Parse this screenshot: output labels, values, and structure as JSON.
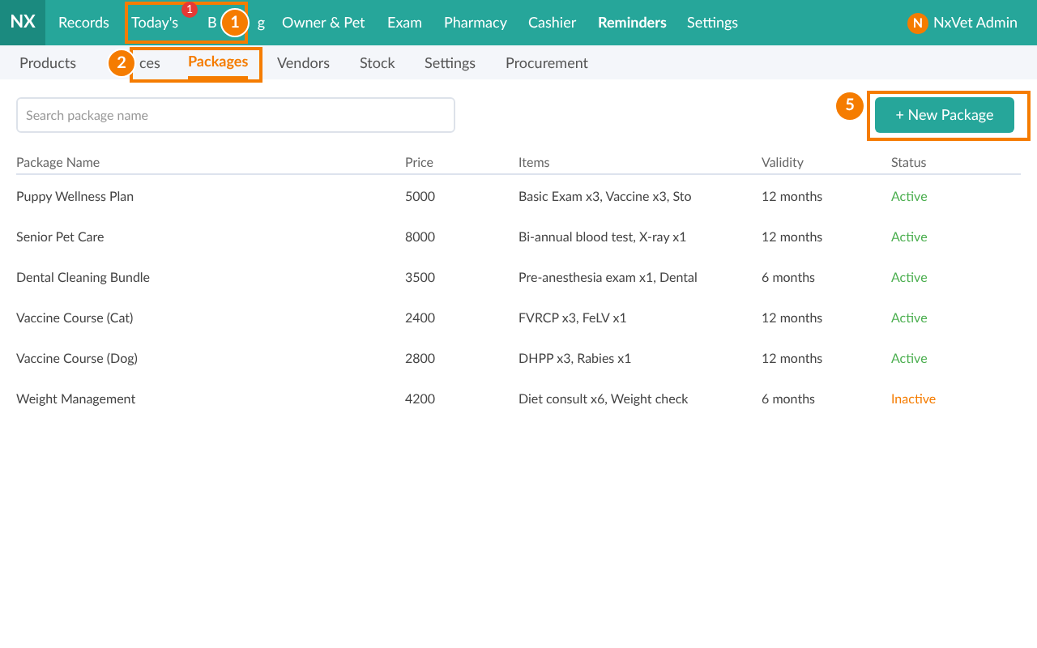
{
  "brand": "NX",
  "nav": [
    {
      "parts": [
        "Records"
      ],
      "selected": false
    },
    {
      "parts": [
        "Today's"
      ],
      "selected": false,
      "badge": "1"
    },
    {
      "parts": [
        "B",
        "g"
      ],
      "selected": false
    },
    {
      "parts": [
        "Owner & Pet"
      ],
      "selected": false
    },
    {
      "parts": [
        "Exam"
      ],
      "selected": false
    },
    {
      "parts": [
        "Pharmacy"
      ],
      "selected": false
    },
    {
      "parts": [
        "Cashier"
      ],
      "selected": false
    },
    {
      "parts": [
        "Reminders"
      ],
      "selected": true
    },
    {
      "parts": [
        "Settings"
      ],
      "selected": false
    }
  ],
  "user": {
    "initial": "N",
    "name": "NxVet Admin"
  },
  "subnav": [
    {
      "label": "Products",
      "selected": false
    },
    {
      "label": "ces",
      "selected": false
    },
    {
      "label": "Packages",
      "selected": true
    },
    {
      "label": "Vendors",
      "selected": false
    },
    {
      "label": "Stock",
      "selected": false
    },
    {
      "label": "Settings",
      "selected": false
    },
    {
      "label": "Procurement",
      "selected": false
    }
  ],
  "search": {
    "placeholder": "Search package name"
  },
  "new_button": "+ New Package",
  "table": {
    "columns": [
      "Package Name",
      "Price",
      "Items",
      "Validity",
      "Status"
    ],
    "rows": [
      {
        "cells": [
          "Puppy Wellness Plan",
          "5000",
          "Basic Exam x3, Vaccine x3, Sto",
          "12 months"
        ],
        "status": "Active",
        "active": true
      },
      {
        "cells": [
          "Senior Pet Care",
          "8000",
          "Bi-annual blood test, X-ray x1",
          "12 months"
        ],
        "status": "Active",
        "active": true
      },
      {
        "cells": [
          "Dental Cleaning Bundle",
          "3500",
          "Pre-anesthesia exam x1, Dental",
          "6 months"
        ],
        "status": "Active",
        "active": true
      },
      {
        "cells": [
          "Vaccine Course (Cat)",
          "2400",
          "FVRCP x3, FeLV x1",
          "12 months"
        ],
        "status": "Active",
        "active": true
      },
      {
        "cells": [
          "Vaccine Course (Dog)",
          "2800",
          "DHPP x3, Rabies x1",
          "12 months"
        ],
        "status": "Active",
        "active": true
      },
      {
        "cells": [
          "Weight Management",
          "4200",
          "Diet consult x6, Weight check",
          "6 months"
        ],
        "status": "Inactive",
        "active": false
      }
    ]
  },
  "callouts": [
    "1",
    "2",
    "5"
  ]
}
